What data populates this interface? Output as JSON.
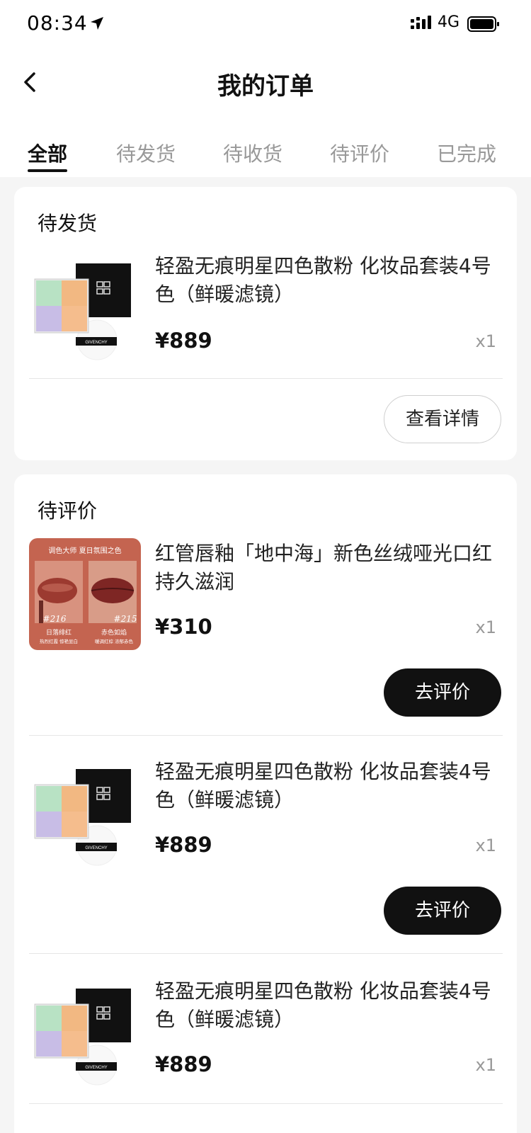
{
  "status_bar": {
    "time": "08:34",
    "network": "4G"
  },
  "header": {
    "title": "我的订单"
  },
  "tabs": [
    {
      "label": "全部",
      "active": true
    },
    {
      "label": "待发货",
      "active": false
    },
    {
      "label": "待收货",
      "active": false
    },
    {
      "label": "待评价",
      "active": false
    },
    {
      "label": "已完成",
      "active": false
    }
  ],
  "orders": [
    {
      "status": "待发货",
      "items": [
        {
          "name": "轻盈无痕明星四色散粉 化妆品套装4号色（鲜暖滤镜）",
          "price": "¥889",
          "qty": "x1",
          "image": "powder-palette-image"
        }
      ],
      "action": "查看详情"
    },
    {
      "status": "待评价",
      "items": [
        {
          "name": "红管唇釉「地中海」新色丝绒哑光口红持久滋润",
          "price": "¥310",
          "qty": "x1",
          "image": "lipstick-image",
          "action": "去评价"
        },
        {
          "name": "轻盈无痕明星四色散粉 化妆品套装4号色（鲜暖滤镜）",
          "price": "¥889",
          "qty": "x1",
          "image": "powder-palette-image",
          "action": "去评价"
        },
        {
          "name": "轻盈无痕明星四色散粉 化妆品套装4号色（鲜暖滤镜）",
          "price": "¥889",
          "qty": "x1",
          "image": "powder-palette-image"
        }
      ]
    }
  ],
  "lip_image": {
    "header": "调色大师 夏日氛围之色",
    "left_shade": "#216",
    "left_name": "日落绯红",
    "left_sub": "热烈红霞 惊艳显白",
    "right_shade": "#215",
    "right_name": "赤色如焰",
    "right_sub": "暖调红棕 浓郁赤色"
  },
  "powder_brand": "GIVENCHY",
  "colors": {
    "accent": "#111111",
    "background": "#f5f5f5",
    "muted": "#999999",
    "lipstick_bg": "#c46450"
  }
}
